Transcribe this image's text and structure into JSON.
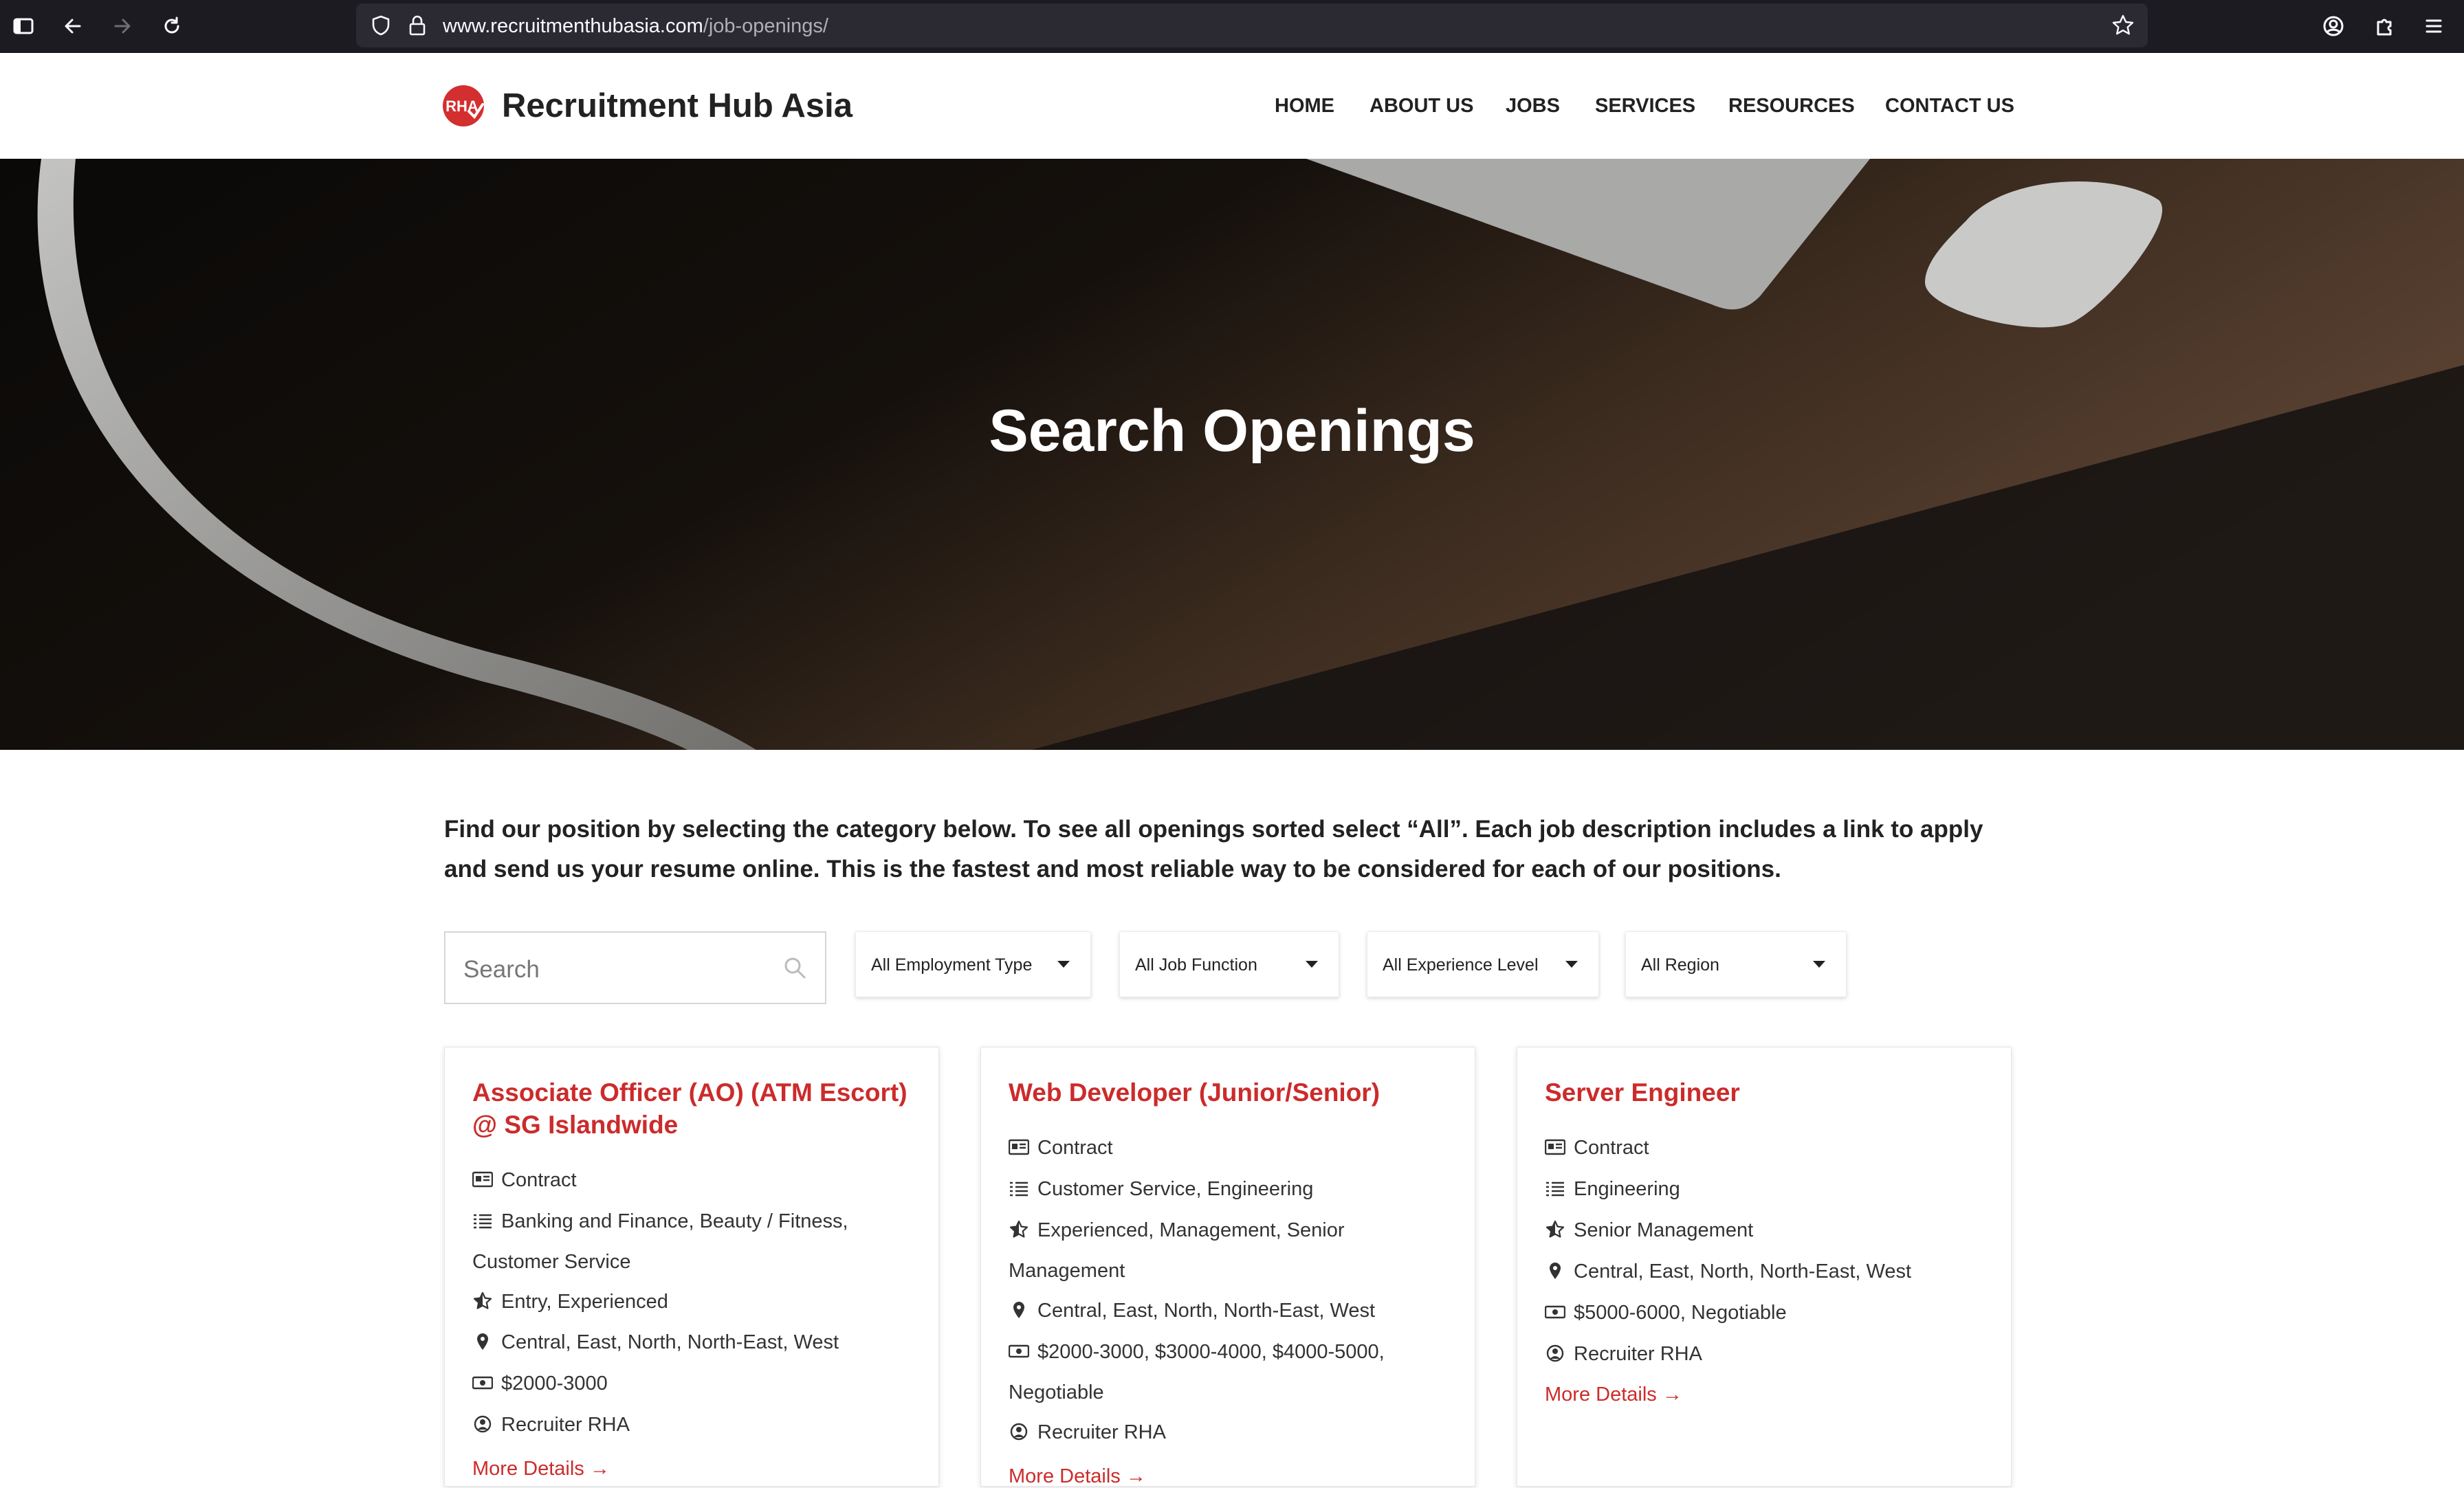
{
  "browser": {
    "url_host": "www.recruitmenthubasia.com",
    "url_path": "/job-openings/"
  },
  "site": {
    "logo_text": "RHA",
    "brand": "Recruitment Hub Asia",
    "brand_color": "#d32f2f",
    "nav": [
      {
        "label": "HOME"
      },
      {
        "label": "ABOUT US"
      },
      {
        "label": "JOBS"
      },
      {
        "label": "SERVICES"
      },
      {
        "label": "RESOURCES"
      },
      {
        "label": "CONTACT US"
      }
    ]
  },
  "hero": {
    "title": "Search Openings"
  },
  "intro": "Find our position by selecting the category below. To see all openings sorted select “All”. Each job description includes a link to apply and send us your resume online. This is the fastest and most reliable way to be considered for each of our positions.",
  "filters": {
    "search_placeholder": "Search",
    "selects": [
      {
        "label": "All Employment Type"
      },
      {
        "label": "All Job Function"
      },
      {
        "label": "All Experience Level"
      },
      {
        "label": "All Region"
      }
    ]
  },
  "jobs": [
    {
      "title": "Associate Officer (AO) (ATM Escort) @ SG Islandwide",
      "employment_type": "Contract",
      "job_function": "Banking and Finance, Beauty / Fitness, Customer Service",
      "experience": "Entry, Experienced",
      "region": "Central, East, North, North-East, West",
      "salary": "$2000-3000",
      "recruiter": "Recruiter RHA",
      "more": "More Details →"
    },
    {
      "title": "Web Developer (Junior/Senior)",
      "employment_type": "Contract",
      "job_function": "Customer Service, Engineering",
      "experience": "Experienced, Management, Senior Management",
      "region": "Central, East, North, North-East, West",
      "salary": "$2000-3000, $3000-4000, $4000-5000, Negotiable",
      "recruiter": "Recruiter RHA",
      "more": "More Details →"
    },
    {
      "title": "Server Engineer",
      "employment_type": "Contract",
      "job_function": "Engineering",
      "experience": "Senior Management",
      "region": "Central, East, North, North-East, West",
      "salary": "$5000-6000, Negotiable",
      "recruiter": "Recruiter RHA",
      "more": "More Details →"
    }
  ],
  "icons": {
    "employment_type": "id-card-icon",
    "job_function": "list-icon",
    "experience": "star-half-icon",
    "region": "map-pin-icon",
    "salary": "money-bill-icon",
    "recruiter": "user-circle-icon"
  }
}
